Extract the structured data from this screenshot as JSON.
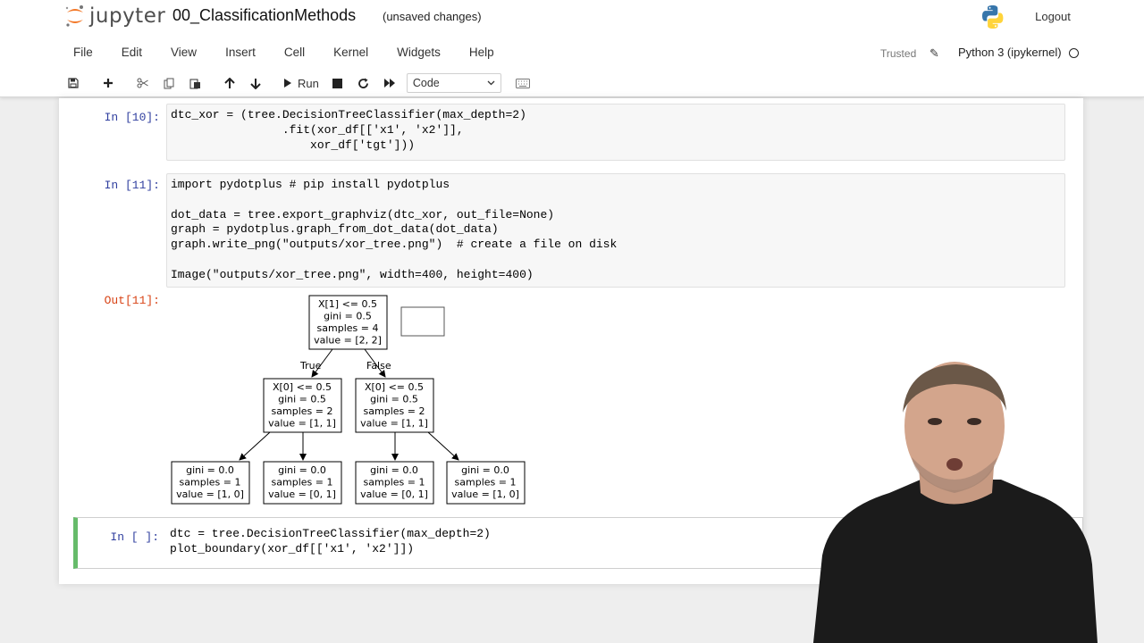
{
  "header": {
    "logo_text": "jupyter",
    "notebook_title": "00_ClassificationMethods",
    "save_status": "(unsaved changes)",
    "logout_label": "Logout"
  },
  "menu": {
    "items": [
      {
        "label": "File"
      },
      {
        "label": "Edit"
      },
      {
        "label": "View"
      },
      {
        "label": "Insert"
      },
      {
        "label": "Cell"
      },
      {
        "label": "Kernel"
      },
      {
        "label": "Widgets"
      },
      {
        "label": "Help"
      }
    ]
  },
  "kernel": {
    "trusted_label": "Trusted",
    "name": "Python 3 (ipykernel)"
  },
  "toolbar": {
    "run_label": "Run",
    "cell_type": "Code",
    "icons": [
      "save-icon",
      "plus-icon",
      "scissors-icon",
      "copy-icon",
      "paste-icon",
      "arrow-up-icon",
      "arrow-down-icon",
      "play-icon",
      "stop-icon",
      "restart-icon",
      "fast-forward-icon",
      "chevron-down-icon",
      "keyboard-icon"
    ]
  },
  "cells": {
    "c10": {
      "prompt": "In [10]:",
      "lines": [
        "dtc_xor = (tree.DecisionTreeClassifier(max_depth=2)",
        "                .fit(xor_df[['x1', 'x2']],",
        "                    xor_df['tgt']))"
      ]
    },
    "c11": {
      "prompt": "In [11]:",
      "out_prompt": "Out[11]:",
      "lines": [
        "import pydotplus # pip install pydotplus",
        "",
        "dot_data = tree.export_graphviz(dtc_xor, out_file=None)",
        "graph = pydotplus.graph_from_dot_data(dot_data)",
        "graph.write_png(\"outputs/xor_tree.png\")  # create a file on disk",
        "",
        "Image(\"outputs/xor_tree.png\", width=400, height=400)"
      ]
    },
    "c12": {
      "prompt": "In [ ]:",
      "lines": [
        "dtc = tree.DecisionTreeClassifier(max_depth=2)",
        "plot_boundary(xor_df[['x1', 'x2']])"
      ]
    }
  },
  "tree": {
    "edge_true": "True",
    "edge_false": "False",
    "root": {
      "lines": [
        "X[1] <= 0.5",
        "gini = 0.5",
        "samples = 4",
        "value = [2, 2]"
      ]
    },
    "left": {
      "lines": [
        "X[0] <= 0.5",
        "gini = 0.5",
        "samples = 2",
        "value = [1, 1]"
      ]
    },
    "right": {
      "lines": [
        "X[0] <= 0.5",
        "gini = 0.5",
        "samples = 2",
        "value = [1, 1]"
      ]
    },
    "ll": {
      "lines": [
        "gini = 0.0",
        "samples = 1",
        "value = [1, 0]"
      ]
    },
    "lr": {
      "lines": [
        "gini = 0.0",
        "samples = 1",
        "value = [0, 1]"
      ]
    },
    "rl": {
      "lines": [
        "gini = 0.0",
        "samples = 1",
        "value = [0, 1]"
      ]
    },
    "rr": {
      "lines": [
        "gini = 0.0",
        "samples = 1",
        "value = [1, 0]"
      ]
    }
  },
  "colors": {
    "prompt_in": "#303f9f",
    "prompt_out": "#d84315",
    "active_cell_border": "#66bb6a"
  }
}
